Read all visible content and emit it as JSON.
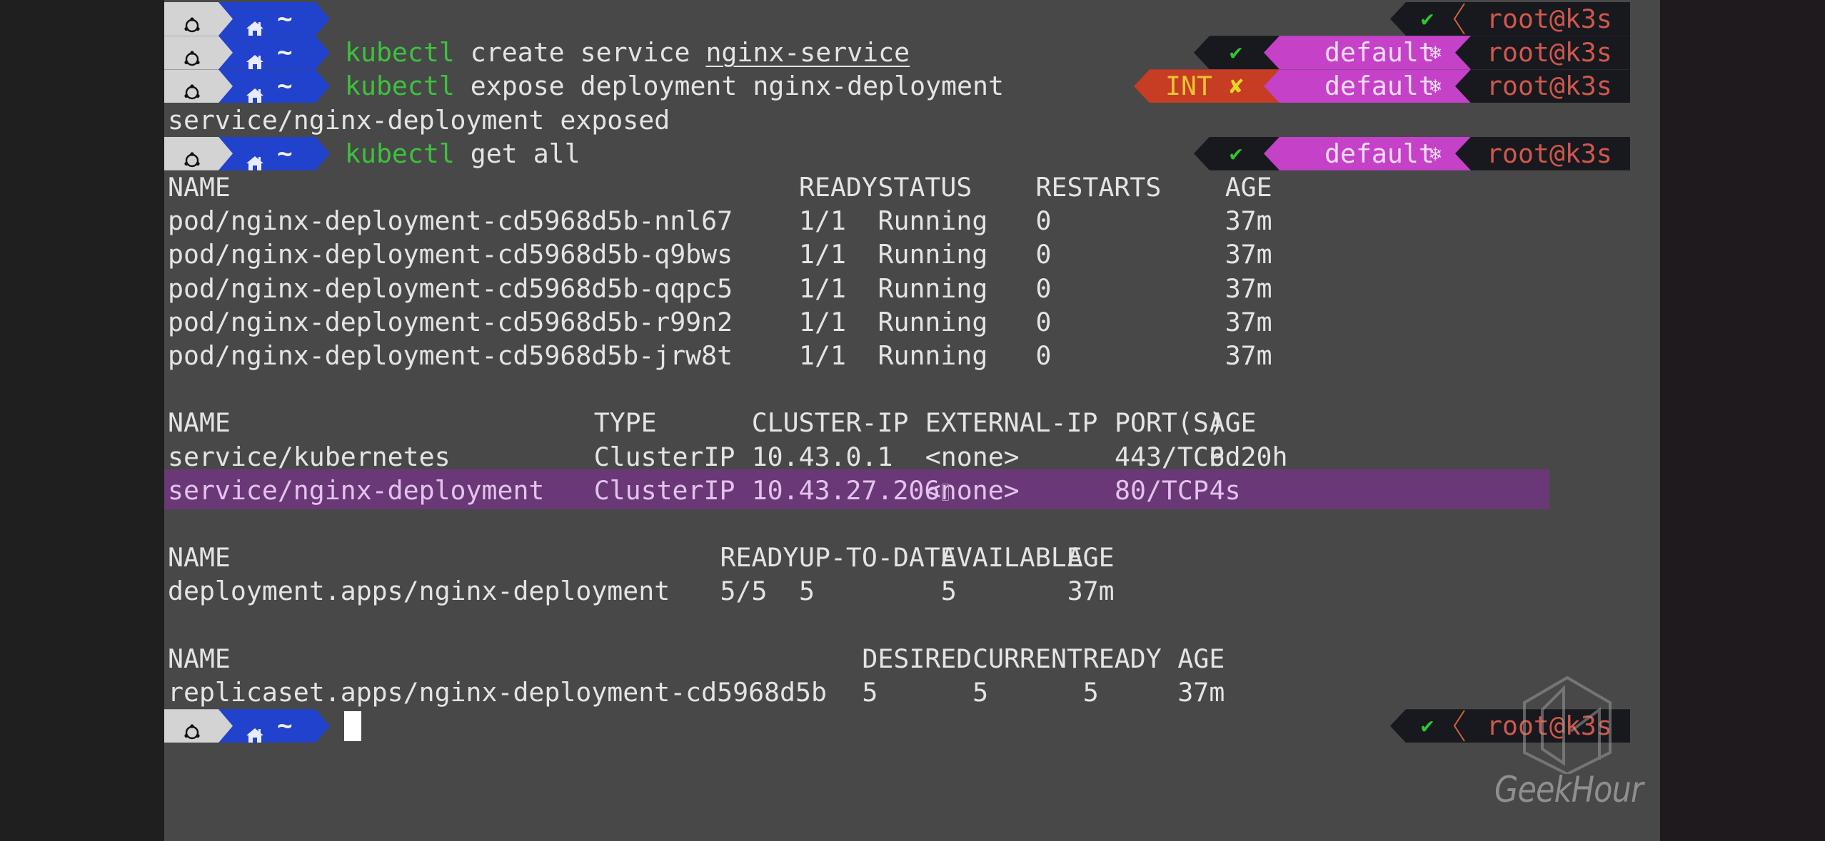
{
  "terminal": {
    "left_prompt": {
      "os_icon": "ubuntu-icon",
      "dir_icon": "home-icon",
      "dir": "~"
    },
    "right_prompt": {
      "status_ok": "✔",
      "status_fail": "✘",
      "interrupt_label": "INT",
      "k8s_context": "default",
      "k8s_icon": "❄",
      "user_host": "root@k3s"
    },
    "commands": [
      {
        "program": "kubectl",
        "args": "create service ",
        "arg_underlined": "nginx-service"
      },
      {
        "program": "kubectl",
        "args": "expose deployment nginx-deployment"
      },
      {
        "program": "kubectl",
        "args": "get all"
      }
    ],
    "expose_output": "service/nginx-deployment exposed",
    "pods": {
      "headers": [
        "NAME",
        "READY",
        "STATUS",
        "RESTARTS",
        "AGE"
      ],
      "rows": [
        [
          "pod/nginx-deployment-cd5968d5b-nnl67",
          "1/1",
          "Running",
          "0",
          "37m"
        ],
        [
          "pod/nginx-deployment-cd5968d5b-q9bws",
          "1/1",
          "Running",
          "0",
          "37m"
        ],
        [
          "pod/nginx-deployment-cd5968d5b-qqpc5",
          "1/1",
          "Running",
          "0",
          "37m"
        ],
        [
          "pod/nginx-deployment-cd5968d5b-r99n2",
          "1/1",
          "Running",
          "0",
          "37m"
        ],
        [
          "pod/nginx-deployment-cd5968d5b-jrw8t",
          "1/1",
          "Running",
          "0",
          "37m"
        ]
      ]
    },
    "services": {
      "headers": [
        "NAME",
        "TYPE",
        "CLUSTER-IP",
        "EXTERNAL-IP",
        "PORT(S)",
        "AGE"
      ],
      "rows": [
        [
          "service/kubernetes",
          "ClusterIP",
          "10.43.0.1",
          "<none>",
          "443/TCP",
          "6d20h"
        ],
        [
          "service/nginx-deployment",
          "ClusterIP",
          "10.43.27.206",
          "<none>",
          "80/TCP",
          "4s"
        ]
      ],
      "highlighted_row": 1
    },
    "deployments": {
      "headers": [
        "NAME",
        "READY",
        "UP-TO-DATE",
        "AVAILABLE",
        "AGE"
      ],
      "rows": [
        [
          "deployment.apps/nginx-deployment",
          "5/5",
          "5",
          "5",
          "37m"
        ]
      ]
    },
    "replicasets": {
      "headers": [
        "NAME",
        "DESIRED",
        "CURRENT",
        "READY",
        "AGE"
      ],
      "rows": [
        [
          "replicaset.apps/nginx-deployment-cd5968d5b",
          "5",
          "5",
          "5",
          "37m"
        ]
      ]
    }
  },
  "watermark": {
    "brand": "GeekHour"
  },
  "colors": {
    "terminal_bg": "#484848",
    "prompt_os_bg": "#d3d3d3",
    "prompt_dir_bg": "#2142cc",
    "command_green": "#3cc23c",
    "k8s_magenta": "#c441c8",
    "int_red": "#c63d23",
    "user_host_red": "#d0584c",
    "selection_purple": "#6b3877"
  }
}
